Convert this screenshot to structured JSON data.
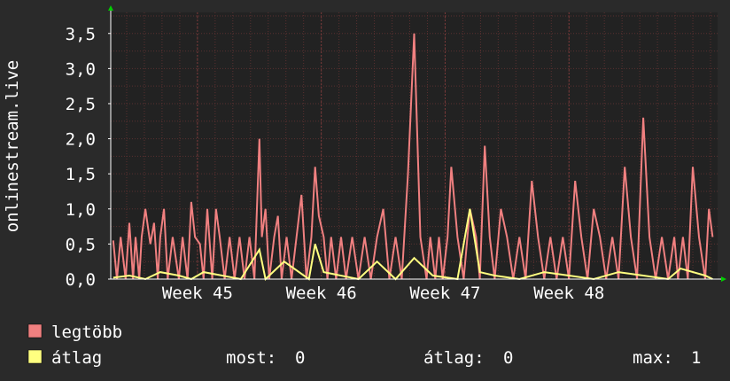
{
  "chart_data": {
    "type": "line",
    "ylabel": "onlinestream.live",
    "ylim": [
      0,
      3.8
    ],
    "y_ticks": [
      "0,0",
      "0,5",
      "1,0",
      "1,5",
      "2,0",
      "2,5",
      "3,0",
      "3,5"
    ],
    "y_tick_values": [
      0,
      0.5,
      1.0,
      1.5,
      2.0,
      2.5,
      3.0,
      3.5
    ],
    "x_ticks": [
      "Week 45",
      "Week 46",
      "Week 47",
      "Week 48"
    ],
    "x_tick_positions": [
      45,
      46,
      47,
      48
    ],
    "xlim": [
      44.3,
      49.2
    ],
    "grid": true,
    "series": [
      {
        "name": "legtöbb",
        "color": "#f08080",
        "x": [
          44.32,
          44.35,
          44.38,
          44.42,
          44.45,
          44.48,
          44.5,
          44.53,
          44.55,
          44.58,
          44.62,
          44.65,
          44.68,
          44.7,
          44.73,
          44.76,
          44.8,
          44.85,
          44.88,
          44.92,
          44.95,
          44.98,
          45.02,
          45.05,
          45.08,
          45.12,
          45.15,
          45.18,
          45.22,
          45.26,
          45.3,
          45.34,
          45.38,
          45.42,
          45.46,
          45.5,
          45.52,
          45.55,
          45.58,
          45.62,
          45.65,
          45.68,
          45.72,
          45.76,
          45.8,
          45.84,
          45.88,
          45.92,
          45.95,
          45.98,
          46.02,
          46.05,
          46.08,
          46.12,
          46.16,
          46.2,
          46.25,
          46.3,
          46.35,
          46.4,
          46.45,
          46.5,
          46.55,
          46.6,
          46.65,
          46.7,
          46.75,
          46.8,
          46.85,
          46.88,
          46.92,
          46.95,
          46.98,
          47.02,
          47.05,
          47.1,
          47.15,
          47.2,
          47.25,
          47.28,
          47.32,
          47.36,
          47.4,
          47.45,
          47.5,
          47.55,
          47.6,
          47.65,
          47.7,
          47.75,
          47.8,
          47.85,
          47.9,
          47.95,
          48.0,
          48.05,
          48.1,
          48.15,
          48.2,
          48.25,
          48.3,
          48.35,
          48.4,
          48.45,
          48.5,
          48.55,
          48.6,
          48.65,
          48.7,
          48.75,
          48.8,
          48.85,
          48.88,
          48.92,
          48.96,
          49.0,
          49.05,
          49.1,
          49.13,
          49.16
        ],
        "values": [
          0.55,
          0.0,
          0.6,
          0.0,
          0.8,
          0.0,
          0.6,
          0.0,
          0.6,
          1.0,
          0.5,
          0.8,
          0.0,
          0.6,
          1.0,
          0.0,
          0.6,
          0.0,
          0.6,
          0.0,
          1.1,
          0.6,
          0.5,
          0.0,
          1.0,
          0.0,
          1.0,
          0.6,
          0.0,
          0.6,
          0.0,
          0.6,
          0.0,
          0.6,
          0.0,
          2.0,
          0.6,
          1.0,
          0.0,
          0.6,
          0.9,
          0.0,
          0.6,
          0.0,
          0.6,
          1.2,
          0.0,
          0.6,
          1.6,
          0.9,
          0.6,
          0.0,
          0.6,
          0.0,
          0.6,
          0.0,
          0.6,
          0.0,
          0.6,
          0.0,
          0.6,
          1.0,
          0.0,
          0.6,
          0.0,
          1.5,
          3.5,
          0.6,
          0.0,
          0.6,
          0.0,
          0.6,
          0.0,
          0.6,
          1.6,
          0.6,
          0.0,
          1.0,
          0.6,
          0.0,
          1.9,
          0.6,
          0.0,
          1.0,
          0.6,
          0.0,
          0.6,
          0.0,
          1.4,
          0.6,
          0.0,
          0.6,
          0.0,
          0.6,
          0.0,
          1.4,
          0.6,
          0.0,
          1.0,
          0.6,
          0.0,
          0.6,
          0.0,
          1.6,
          0.6,
          0.0,
          2.3,
          0.6,
          0.0,
          0.6,
          0.0,
          0.6,
          0.0,
          0.6,
          0.0,
          1.6,
          0.6,
          0.0,
          1.0,
          0.6
        ]
      },
      {
        "name": "átlag",
        "color": "#ffff80",
        "x": [
          44.32,
          44.45,
          44.58,
          44.7,
          44.85,
          44.95,
          45.05,
          45.2,
          45.35,
          45.5,
          45.55,
          45.7,
          45.9,
          45.95,
          46.02,
          46.3,
          46.45,
          46.6,
          46.75,
          46.9,
          47.1,
          47.2,
          47.28,
          47.4,
          47.6,
          47.8,
          48.0,
          48.2,
          48.4,
          48.6,
          48.8,
          48.9,
          49.1,
          49.16
        ],
        "values": [
          0.02,
          0.05,
          0.0,
          0.1,
          0.05,
          0.0,
          0.1,
          0.05,
          0.0,
          0.42,
          0.0,
          0.25,
          0.0,
          0.5,
          0.1,
          0.0,
          0.25,
          0.0,
          0.3,
          0.05,
          0.0,
          1.0,
          0.1,
          0.05,
          0.0,
          0.1,
          0.05,
          0.0,
          0.1,
          0.05,
          0.0,
          0.15,
          0.05,
          0.0
        ]
      }
    ]
  },
  "legend": {
    "items": [
      {
        "name": "legtöbb",
        "color": "#f08080"
      },
      {
        "name": "átlag",
        "color": "#ffff80"
      }
    ],
    "stats": {
      "most_label": "most:",
      "most_value": "0",
      "avg_label": "átlag:",
      "avg_value": "0",
      "max_label": "max:",
      "max_value": "1"
    }
  },
  "colors": {
    "background": "#2a2a2a",
    "plot_background": "#222222",
    "grid": "#5a3030",
    "text": "#ffffff",
    "axis_arrow": "#00cc00"
  }
}
